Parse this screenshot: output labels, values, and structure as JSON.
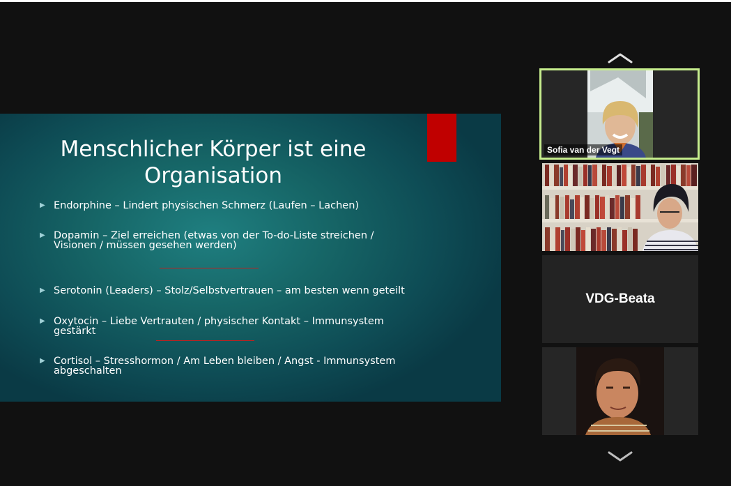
{
  "slide": {
    "title": "Menschlicher Körper ist eine Organisation",
    "bullets": [
      "Endorphine – Lindert physischen Schmerz (Laufen – Lachen)",
      "Dopamin – Ziel erreichen (etwas von der To-do-Liste streichen / Visionen / müssen gesehen werden)",
      "Serotonin (Leaders) – Stolz/Selbstvertrauen – am besten wenn geteilt",
      "Oxytocin – Liebe Vertrauten / physischer Kontakt – Immunsystem gestärkt",
      "Cortisol – Stresshormon / Am Leben bleiben / Angst -  Immunsystem abgeschalten"
    ],
    "accent_color": "#c00000",
    "bullet_icon": "triangle-bullet-icon"
  },
  "participants": [
    {
      "name": "Sofia van der Vegt",
      "video": true,
      "active_speaker": true
    },
    {
      "name": "",
      "video": true,
      "active_speaker": false
    },
    {
      "name": "VDG-Beata",
      "video": false,
      "active_speaker": false
    },
    {
      "name": "",
      "video": true,
      "active_speaker": false
    }
  ],
  "controls": {
    "scroll_up_icon": "chevron-up-icon",
    "scroll_down_icon": "chevron-down-icon"
  },
  "colors": {
    "background": "#111111",
    "active_speaker_border": "#c7ee8e",
    "tile_background": "#232323"
  }
}
